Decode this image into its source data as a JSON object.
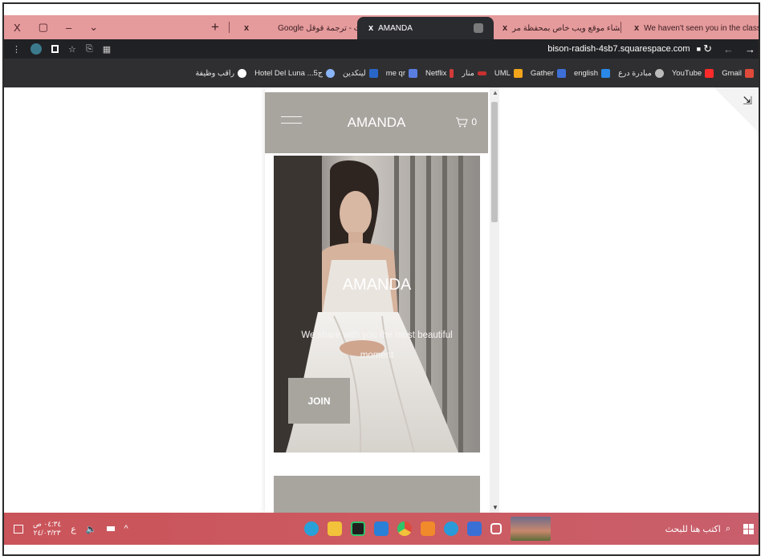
{
  "window": {
    "controls": [
      "X",
      "▢",
      "–",
      "⌄"
    ]
  },
  "tabs": [
    {
      "label": "Google بحث - ترجمة قوقل",
      "fav_color": "#ffffff",
      "active": false
    },
    {
      "label": "AMANDA",
      "fav_color": "#888888",
      "active": true
    },
    {
      "label": "إنشاء موقع ويب خاص بمحفظة مر",
      "fav_color": "#3d6fd6",
      "active": false
    },
    {
      "label": "We haven't seen you in the class",
      "fav_color": "#d33a3a",
      "active": false
    }
  ],
  "new_tab_label": "+",
  "close_glyph": "x",
  "addressbar": {
    "url": "bison-radish-4sb7.squarespace.com",
    "lock": "🔒",
    "reload": "↻",
    "back": "←",
    "forward": "→",
    "menu": "⋮",
    "star": "☆"
  },
  "bookmarks": [
    {
      "label": "راقب وظيفة",
      "color": "#ffffff"
    },
    {
      "label": "Hotel Del Luna ...ج5",
      "color": "#ffffff"
    },
    {
      "label": "لينكدين",
      "color": "#2a66c8"
    },
    {
      "label": "me qr",
      "color": "#2a66c8"
    },
    {
      "label": "Netflix",
      "color": "#d33a3a"
    },
    {
      "label": "منار",
      "color": "#d33a3a"
    },
    {
      "label": "UML",
      "color": "#f2a51a"
    },
    {
      "label": "Gather",
      "color": "#3d6fd6"
    },
    {
      "label": "english",
      "color": "#2a88e8"
    },
    {
      "label": "مبادرة درع",
      "color": "#bbbbbb"
    },
    {
      "label": "YouTube",
      "color": "#ff2a2a"
    },
    {
      "label": "Gmail",
      "color": "#e04a3a"
    }
  ],
  "site": {
    "brand": "AMANDA",
    "cart_count": "0",
    "hero_title": "AMANDA",
    "hero_subtitle": "We share with you the most beautiful moment",
    "join_label": "JOIN"
  },
  "corner_icon": "⇲",
  "taskbar": {
    "search_placeholder": "اكتب هنا للبحث",
    "time": "٠٤:٣٤ ص",
    "date": "٢٤/٠٣/٢٣",
    "lang": "ع",
    "apps": [
      {
        "name": "telegram",
        "color": "#2aa0d8"
      },
      {
        "name": "files",
        "color": "#f2c23a"
      },
      {
        "name": "pycharm",
        "color": "#2ec46a"
      },
      {
        "name": "mail",
        "color": "#2a7fd6"
      },
      {
        "name": "chrome",
        "color": "#f1b42a"
      },
      {
        "name": "vscode-like",
        "color": "#f08a2a"
      },
      {
        "name": "edge",
        "color": "#2b9ad8"
      },
      {
        "name": "store",
        "color": "#3a6fd6"
      },
      {
        "name": "taskview",
        "color": "#e8e8e8"
      }
    ]
  }
}
